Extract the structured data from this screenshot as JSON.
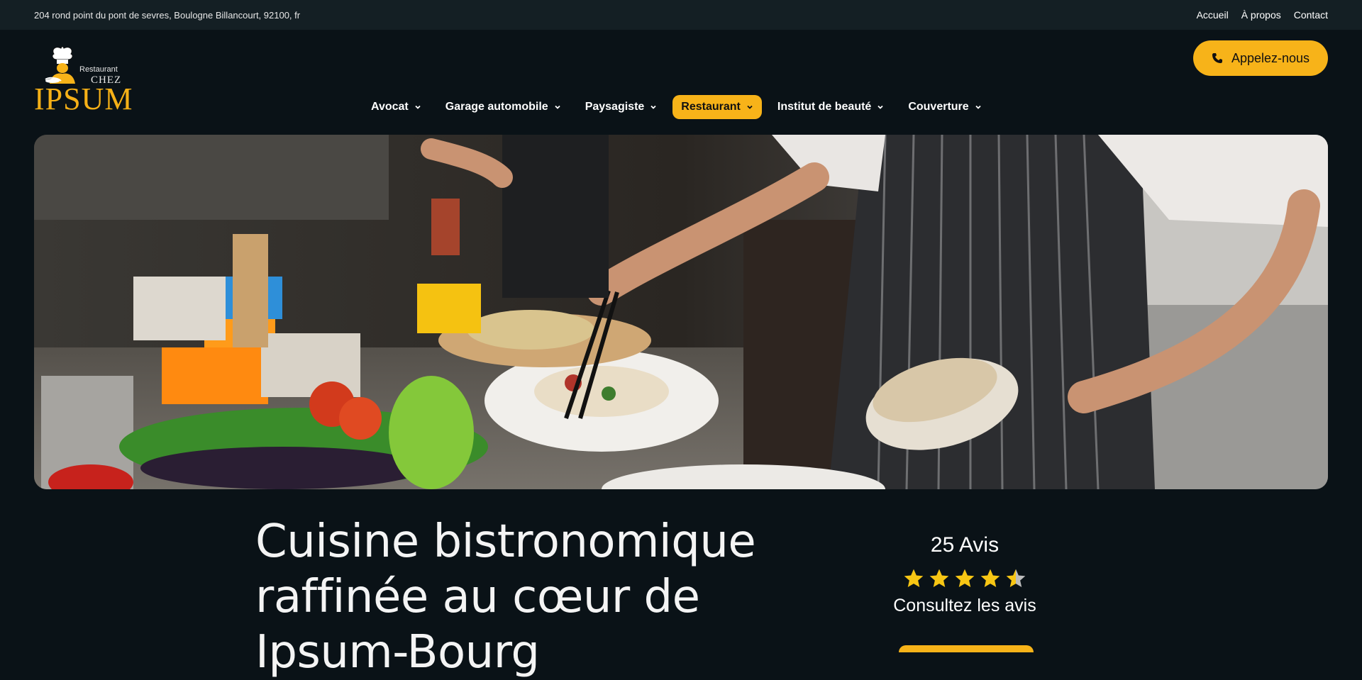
{
  "topbar": {
    "address": "204 rond point du pont de sevres, Boulogne Billancourt, 92100, fr",
    "links": [
      "Accueil",
      "À propos",
      "Contact"
    ]
  },
  "logo": {
    "line1": "Restaurant",
    "line2": "CHEZ",
    "brand": "IPSUM"
  },
  "call_button": {
    "label": "Appelez-nous",
    "icon": "phone-icon"
  },
  "nav": {
    "items": [
      {
        "label": "Avocat",
        "active": false
      },
      {
        "label": "Garage automobile",
        "active": false
      },
      {
        "label": "Paysagiste",
        "active": false
      },
      {
        "label": "Restaurant",
        "active": true
      },
      {
        "label": "Institut de beauté",
        "active": false
      },
      {
        "label": "Couverture",
        "active": false
      }
    ]
  },
  "hero": {
    "description": "kitchen-photo"
  },
  "headline": "Cuisine bistronomique raffinée au cœur de Ipsum-Bourg",
  "reviews": {
    "count_label": "25 Avis",
    "rating": 4.5,
    "max_rating": 5,
    "consult_label": "Consultez les avis"
  },
  "colors": {
    "accent": "#f7b319",
    "background": "#0a1217",
    "topbar": "#141f24"
  }
}
